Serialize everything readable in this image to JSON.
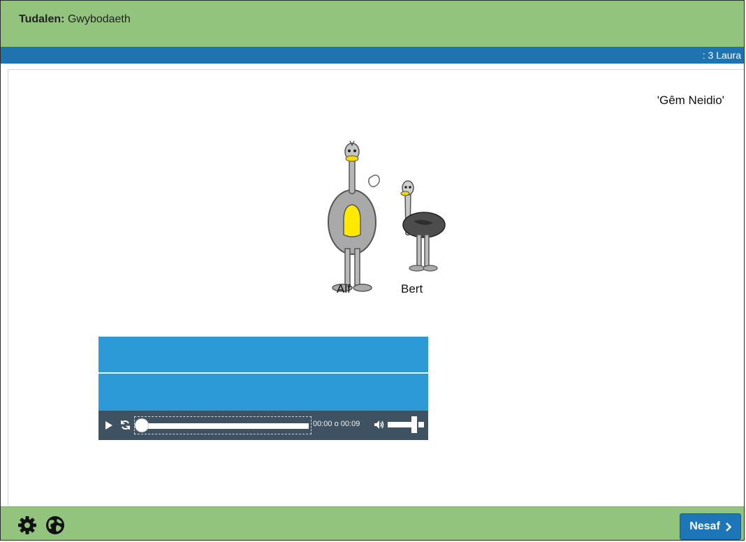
{
  "header": {
    "page_label": "Tudalen:",
    "page_name": "Gwybodaeth"
  },
  "progress_bar": {
    "user_text": ": 3 Laura"
  },
  "content": {
    "game_title": "'Gêm Neidio'",
    "characters": [
      "Alf",
      "Bert"
    ]
  },
  "media_player": {
    "time_current": "00:00",
    "time_separator": "o",
    "time_total": "00:09",
    "position_fraction": 0,
    "volume_fraction": 0.85
  },
  "footer": {
    "settings_icon": "gear-icon",
    "language_icon": "globe-icon",
    "next_label": "Nesaf"
  },
  "colors": {
    "header_green": "#93c47d",
    "progress_blue": "#1f73ae",
    "player_blue": "#2b9ad6",
    "controls_dark": "#3e5261",
    "button_blue": "#1d76b7"
  }
}
